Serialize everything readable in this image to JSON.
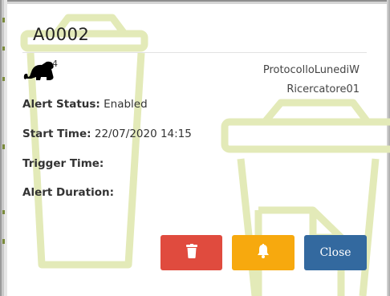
{
  "dialog": {
    "title": "A0002",
    "dino_count": "4",
    "protocol": "ProtocolloLunediW",
    "researcher": "Ricercatore01"
  },
  "fields": {
    "alert_status_label": "Alert Status:",
    "alert_status_value": "Enabled",
    "start_time_label": "Start Time:",
    "start_time_value": "22/07/2020 14:15",
    "trigger_time_label": "Trigger Time:",
    "trigger_time_value": "",
    "alert_duration_label": "Alert Duration:",
    "alert_duration_value": ""
  },
  "buttons": {
    "delete_icon": "trash-icon",
    "alert_icon": "bell-icon",
    "close_label": "Close"
  },
  "colors": {
    "delete": "#e04b3e",
    "alert": "#f7a90e",
    "close": "#33699f",
    "watermark": "#e6ecbf"
  }
}
